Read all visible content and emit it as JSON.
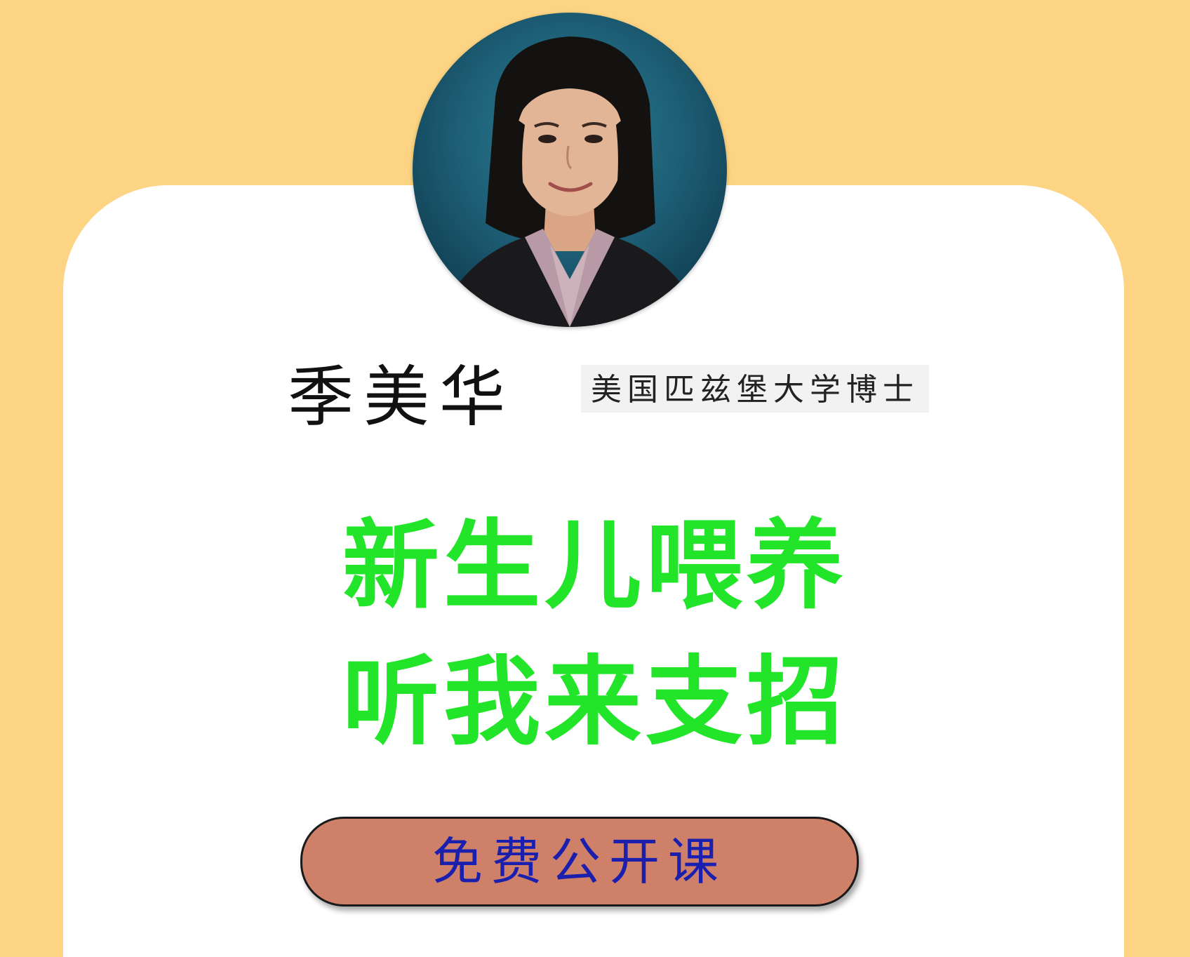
{
  "profile": {
    "name": "季美华",
    "credential": "美国匹兹堡大学博士",
    "avatar_icon": "teacher-portrait"
  },
  "headline": {
    "line1": "新生儿喂养",
    "line2": "听我来支招"
  },
  "cta": {
    "label": "免费公开课"
  },
  "colors": {
    "background": "#fdd483",
    "card": "#ffffff",
    "headline": "#22e52a",
    "cta_fill": "#cf8069",
    "cta_text": "#1a1fae"
  }
}
